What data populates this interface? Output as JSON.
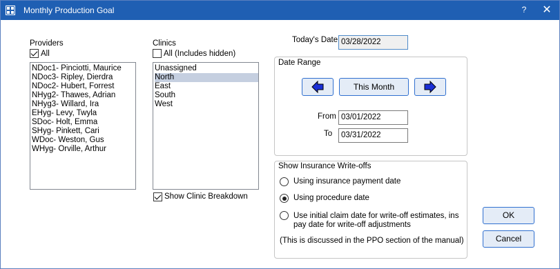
{
  "window": {
    "title": "Monthly Production Goal",
    "help_glyph": "?",
    "close_glyph": "✕"
  },
  "providers": {
    "label": "Providers",
    "all_label": "All",
    "all_checked": true,
    "items": [
      "NDoc1- Pinciotti, Maurice",
      "NDoc3- Ripley, Dierdra",
      "NDoc2- Hubert, Forrest",
      "NHyg2- Thawes, Adrian",
      "NHyg3- Willard, Ira",
      "EHyg- Levy, Twyla",
      "SDoc- Holt, Emma",
      "SHyg- Pinkett, Cari",
      "WDoc- Weston, Gus",
      "WHyg- Orville, Arthur"
    ]
  },
  "clinics": {
    "label": "Clinics",
    "all_label": "All (Includes hidden)",
    "all_checked": false,
    "items": [
      "Unassigned",
      "North",
      "East",
      "South",
      "West"
    ],
    "selected": "North",
    "breakdown_label": "Show Clinic Breakdown",
    "breakdown_checked": true
  },
  "todays_date": {
    "label": "Today's Date",
    "value": "03/28/2022"
  },
  "date_range": {
    "title": "Date Range",
    "this_month_label": "This Month",
    "from_label": "From",
    "from_value": "03/01/2022",
    "to_label": "To",
    "to_value": "03/31/2022"
  },
  "writeoffs": {
    "title": "Show Insurance Write-offs",
    "options": [
      {
        "label": "Using insurance payment date",
        "checked": false
      },
      {
        "label": "Using procedure date",
        "checked": true
      },
      {
        "label_line1": "Use initial claim date for write-off estimates, ins",
        "label_line2": "pay date for write-off adjustments",
        "checked": false
      }
    ],
    "note": "(This is discussed in the PPO section of the manual)"
  },
  "buttons": {
    "ok": "OK",
    "cancel": "Cancel"
  },
  "colors": {
    "titlebar": "#1f5fb3",
    "arrow_fill": "#1a2fd6",
    "selection": "#c5cfe0"
  }
}
